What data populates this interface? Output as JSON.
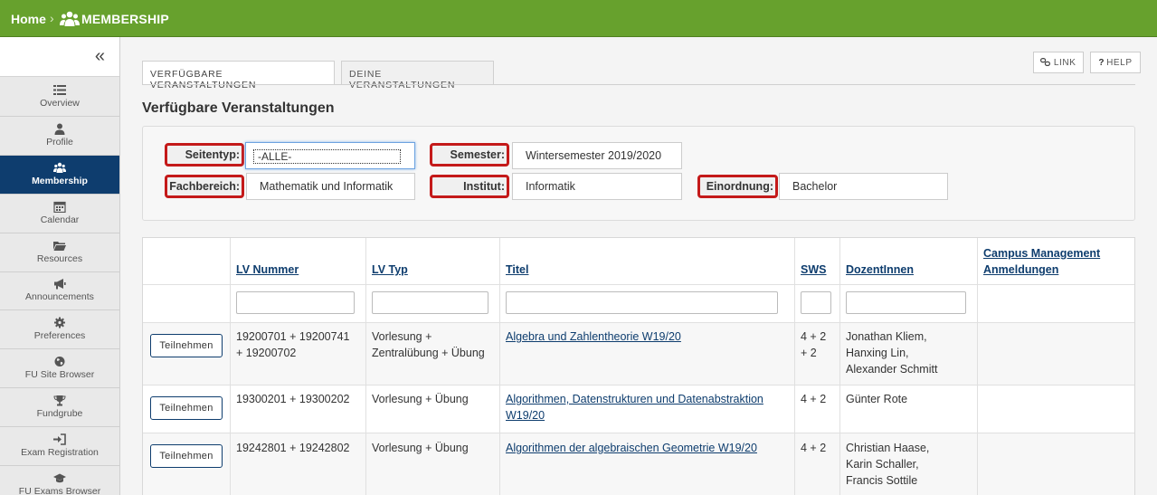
{
  "breadcrumb": {
    "home": "Home",
    "separator": "›",
    "current": "MEMBERSHIP"
  },
  "sidebar": {
    "collapse_glyph": "«",
    "items": [
      {
        "label": "Overview",
        "icon": "list-icon",
        "active": false
      },
      {
        "label": "Profile",
        "icon": "user-icon",
        "active": false
      },
      {
        "label": "Membership",
        "icon": "group-icon",
        "active": true
      },
      {
        "label": "Calendar",
        "icon": "calendar-icon",
        "active": false
      },
      {
        "label": "Resources",
        "icon": "folder-icon",
        "active": false
      },
      {
        "label": "Announcements",
        "icon": "megaphone-icon",
        "active": false
      },
      {
        "label": "Preferences",
        "icon": "gear-icon",
        "active": false
      },
      {
        "label": "FU Site Browser",
        "icon": "globe-icon",
        "active": false
      },
      {
        "label": "Fundgrube",
        "icon": "trophy-icon",
        "active": false
      },
      {
        "label": "Exam Registration",
        "icon": "sign-in-icon",
        "active": false
      },
      {
        "label": "FU Exams Browser",
        "icon": "graduation-cap-icon",
        "active": false
      }
    ]
  },
  "tabs": [
    {
      "label": "VERFÜGBARE VERANSTALTUNGEN",
      "active": true
    },
    {
      "label": "DEINE VERANSTALTUNGEN",
      "active": false
    }
  ],
  "header_buttons": {
    "link": "LINK",
    "help_glyph": "?",
    "help": "HELP"
  },
  "page_title": "Verfügbare Veranstaltungen",
  "filters": {
    "seitentyp": {
      "label": "Seitentyp:",
      "value": "-ALLE-"
    },
    "semester": {
      "label": "Semester:",
      "value": "Wintersemester 2019/2020"
    },
    "fachbereich": {
      "label": "Fachbereich:",
      "value": "Mathematik und Informatik"
    },
    "institut": {
      "label": "Institut:",
      "value": "Informatik"
    },
    "einordnung": {
      "label": "Einordnung:",
      "value": "Bachelor"
    }
  },
  "table": {
    "headers": {
      "lv_nummer": "LV Nummer",
      "lv_typ": "LV Typ",
      "titel": "Titel",
      "sws": "SWS",
      "dozenten": "DozentInnen",
      "campus_1": "Campus Management",
      "campus_2": "Anmeldungen"
    },
    "join_label": "Teilnehmen",
    "rows": [
      {
        "nummer": [
          "19200701 + 19200741",
          "+ 19200702"
        ],
        "typ": [
          "Vorlesung +",
          "Zentralübung + Übung"
        ],
        "titel": [
          "Algebra und Zahlentheorie W19/20"
        ],
        "sws": [
          "4 + 2",
          "+ 2"
        ],
        "dozenten": [
          "Jonathan Kliem,",
          "Hanxing Lin,",
          "Alexander Schmitt"
        ]
      },
      {
        "nummer": [
          "19300201 + 19300202"
        ],
        "typ": [
          "Vorlesung + Übung"
        ],
        "titel": [
          "Algorithmen, Datenstrukturen und Datenabstraktion",
          "W19/20"
        ],
        "sws": [
          "4 + 2"
        ],
        "dozenten": [
          "Günter Rote"
        ]
      },
      {
        "nummer": [
          "19242801 + 19242802"
        ],
        "typ": [
          "Vorlesung + Übung"
        ],
        "titel": [
          "Algorithmen der algebraischen Geometrie W19/20"
        ],
        "sws": [
          "4 + 2"
        ],
        "dozenten": [
          "Christian Haase,",
          "Karin Schaller,",
          "Francis Sottile"
        ]
      }
    ]
  },
  "colors": {
    "topbar": "#67a12d",
    "nav_active": "#0e3d6e",
    "highlight": "#c41a1a",
    "link": "#0e3d6e"
  }
}
